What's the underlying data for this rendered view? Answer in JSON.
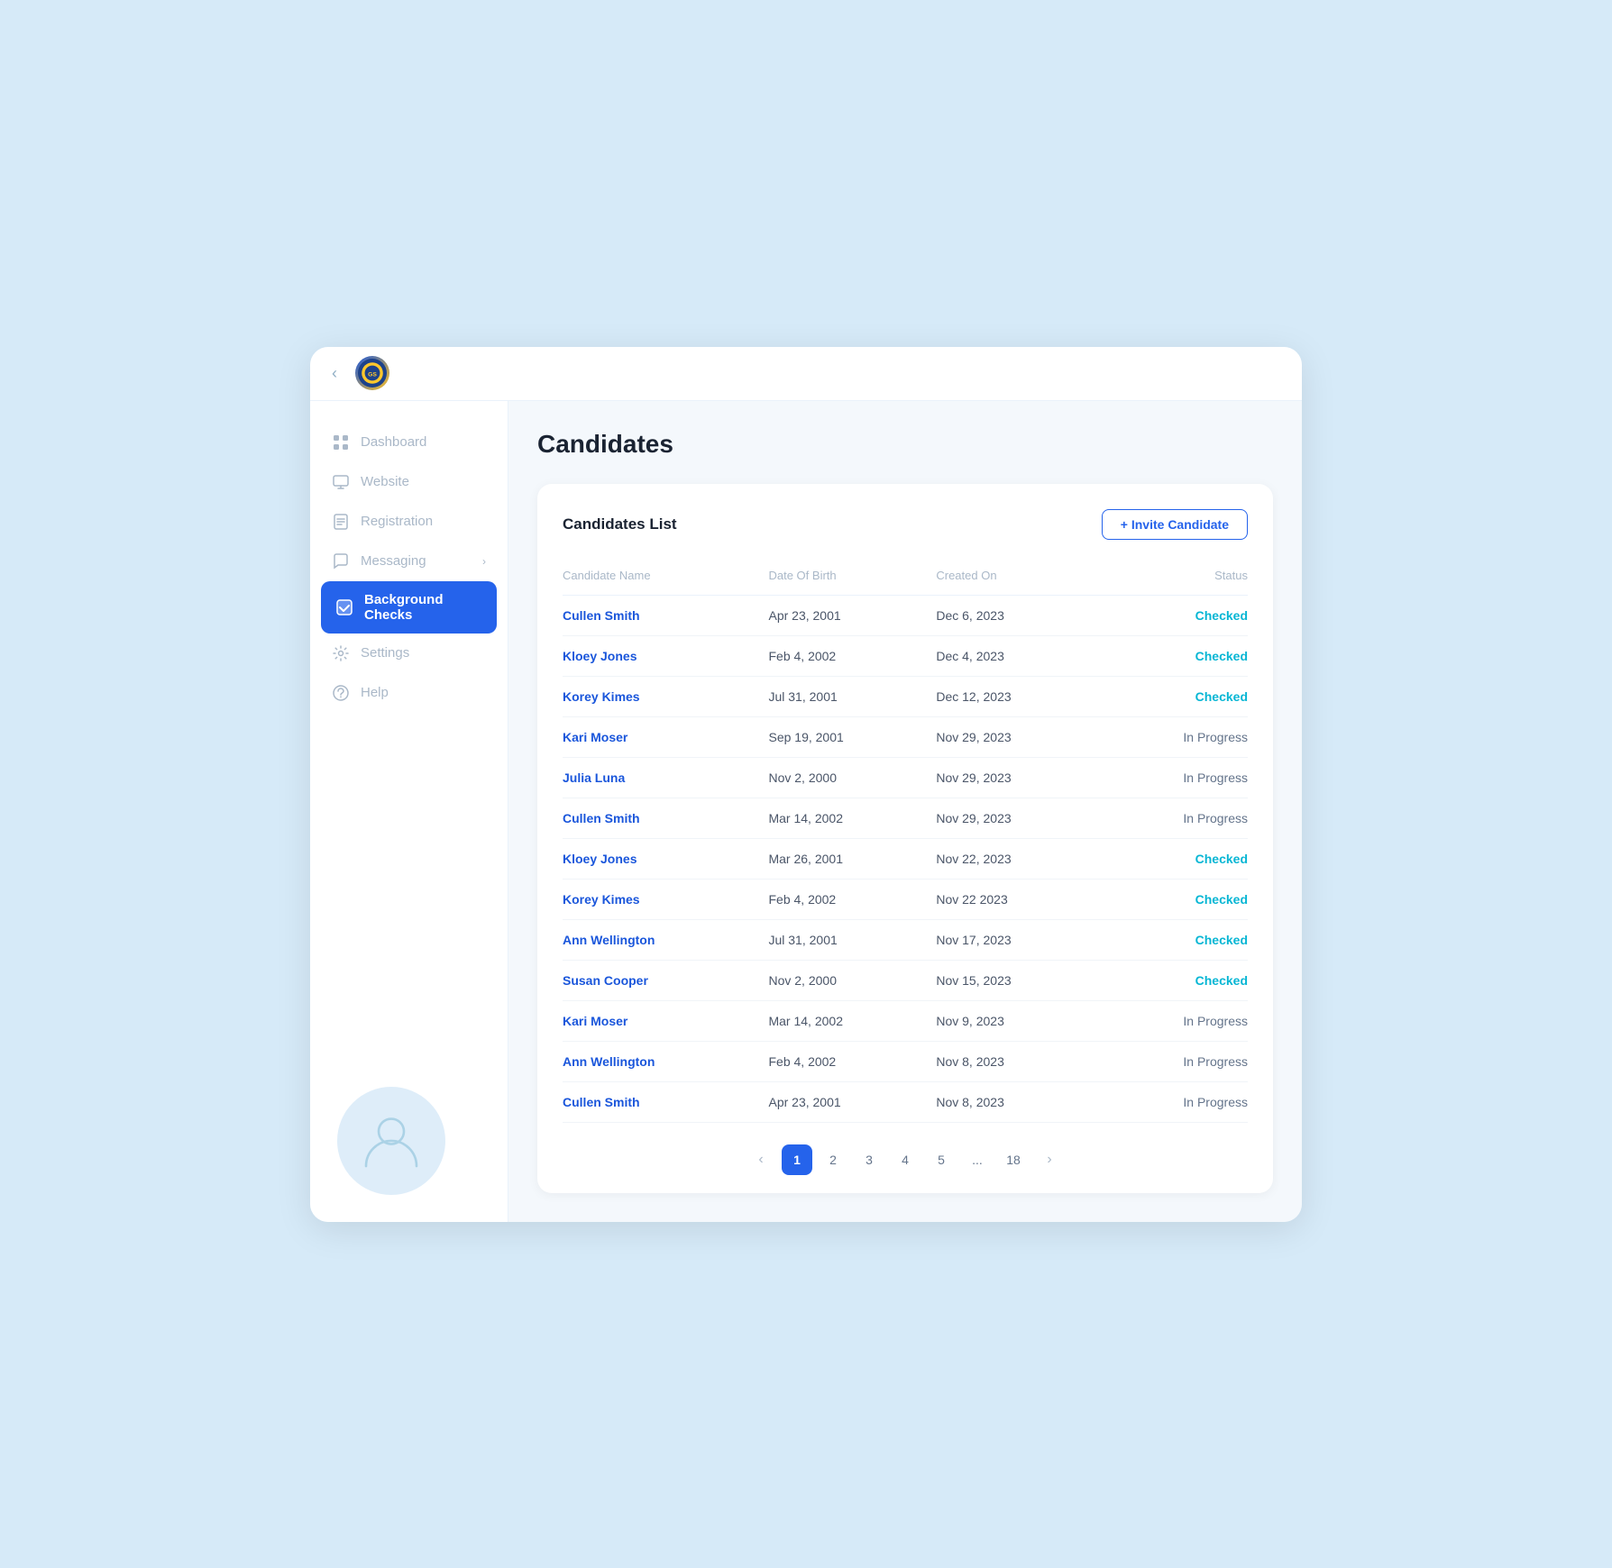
{
  "topbar": {
    "back_label": "‹"
  },
  "sidebar": {
    "items": [
      {
        "id": "dashboard",
        "label": "Dashboard",
        "icon": "grid-icon",
        "active": false
      },
      {
        "id": "website",
        "label": "Website",
        "icon": "monitor-icon",
        "active": false
      },
      {
        "id": "registration",
        "label": "Registration",
        "icon": "form-icon",
        "active": false
      },
      {
        "id": "messaging",
        "label": "Messaging",
        "icon": "chat-icon",
        "active": false,
        "hasChevron": true
      },
      {
        "id": "background-checks",
        "label": "Background Checks",
        "icon": "check-icon",
        "active": true
      },
      {
        "id": "settings",
        "label": "Settings",
        "icon": "gear-icon",
        "active": false
      },
      {
        "id": "help",
        "label": "Help",
        "icon": "help-icon",
        "active": false
      }
    ]
  },
  "page": {
    "title": "Candidates"
  },
  "candidates_list": {
    "title": "Candidates List",
    "invite_button": "+ Invite Candidate",
    "columns": {
      "name": "Candidate Name",
      "dob": "Date Of Birth",
      "created": "Created On",
      "status": "Status"
    },
    "rows": [
      {
        "name": "Cullen Smith",
        "dob": "Apr 23, 2001",
        "created": "Dec 6, 2023",
        "status": "Checked",
        "status_type": "checked"
      },
      {
        "name": "Kloey Jones",
        "dob": "Feb 4, 2002",
        "created": "Dec 4, 2023",
        "status": "Checked",
        "status_type": "checked"
      },
      {
        "name": "Korey Kimes",
        "dob": "Jul 31, 2001",
        "created": "Dec 12, 2023",
        "status": "Checked",
        "status_type": "checked"
      },
      {
        "name": "Kari Moser",
        "dob": "Sep 19, 2001",
        "created": "Nov 29, 2023",
        "status": "In Progress",
        "status_type": "inprogress"
      },
      {
        "name": "Julia Luna",
        "dob": "Nov 2, 2000",
        "created": "Nov 29, 2023",
        "status": "In Progress",
        "status_type": "inprogress"
      },
      {
        "name": "Cullen Smith",
        "dob": "Mar 14, 2002",
        "created": "Nov 29, 2023",
        "status": "In Progress",
        "status_type": "inprogress"
      },
      {
        "name": "Kloey Jones",
        "dob": "Mar 26, 2001",
        "created": "Nov 22, 2023",
        "status": "Checked",
        "status_type": "checked"
      },
      {
        "name": "Korey Kimes",
        "dob": "Feb 4, 2002",
        "created": "Nov 22 2023",
        "status": "Checked",
        "status_type": "checked"
      },
      {
        "name": "Ann Wellington",
        "dob": "Jul 31, 2001",
        "created": "Nov 17, 2023",
        "status": "Checked",
        "status_type": "checked"
      },
      {
        "name": "Susan Cooper",
        "dob": "Nov 2, 2000",
        "created": "Nov 15, 2023",
        "status": "Checked",
        "status_type": "checked"
      },
      {
        "name": "Kari Moser",
        "dob": "Mar 14, 2002",
        "created": "Nov 9, 2023",
        "status": "In Progress",
        "status_type": "inprogress"
      },
      {
        "name": "Ann Wellington",
        "dob": "Feb 4, 2002",
        "created": "Nov 8, 2023",
        "status": "In Progress",
        "status_type": "inprogress"
      },
      {
        "name": "Cullen Smith",
        "dob": "Apr 23, 2001",
        "created": "Nov 8, 2023",
        "status": "In Progress",
        "status_type": "inprogress"
      }
    ]
  },
  "pagination": {
    "pages": [
      "1",
      "2",
      "3",
      "4",
      "5",
      "...",
      "18"
    ],
    "current": "1"
  }
}
